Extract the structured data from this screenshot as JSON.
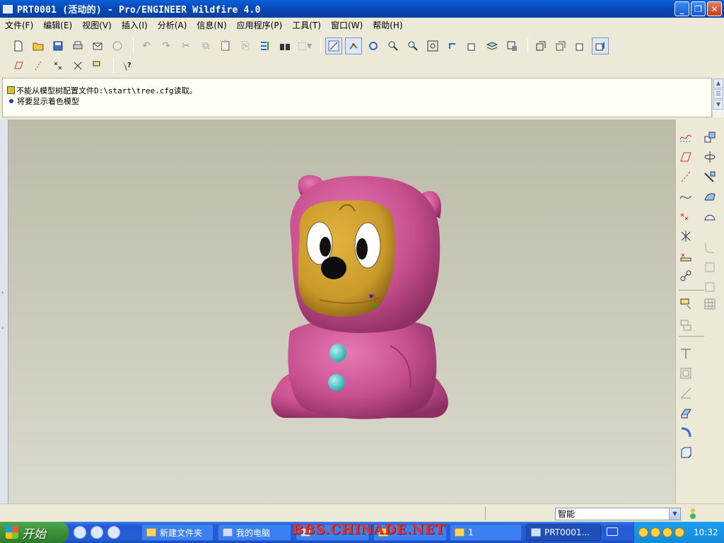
{
  "window": {
    "title": "PRT0001 (活动的) - Pro/ENGINEER Wildfire 4.0",
    "controls": {
      "minimize": "_",
      "restore": "❐",
      "close": "✕"
    }
  },
  "menu": [
    "文件(F)",
    "编辑(E)",
    "视图(V)",
    "插入(I)",
    "分析(A)",
    "信息(N)",
    "应用程序(P)",
    "工具(T)",
    "窗口(W)",
    "帮助(H)"
  ],
  "messages": {
    "line1": "不能从模型树配置文件D:\\start\\tree.cfg读取。",
    "line2": "将要显示着色模型"
  },
  "statusbar": {
    "filter_value": "智能"
  },
  "taskbar": {
    "start_label": "开始",
    "tasks": [
      {
        "label": "新建文件夹"
      },
      {
        "label": "我的电脑"
      },
      {
        "label": ""
      },
      {
        "label": ""
      },
      {
        "label": "1"
      },
      {
        "label": "PRT0001..."
      }
    ],
    "clock": "10:32",
    "watermark": "BBS.CHINADE.NET"
  },
  "colors": {
    "model_body": "#c8508f",
    "model_face": "#c99a2a",
    "buttons": "#3fc6c8",
    "background_top": "#bcbaa9",
    "background_bottom": "#dadacd"
  }
}
